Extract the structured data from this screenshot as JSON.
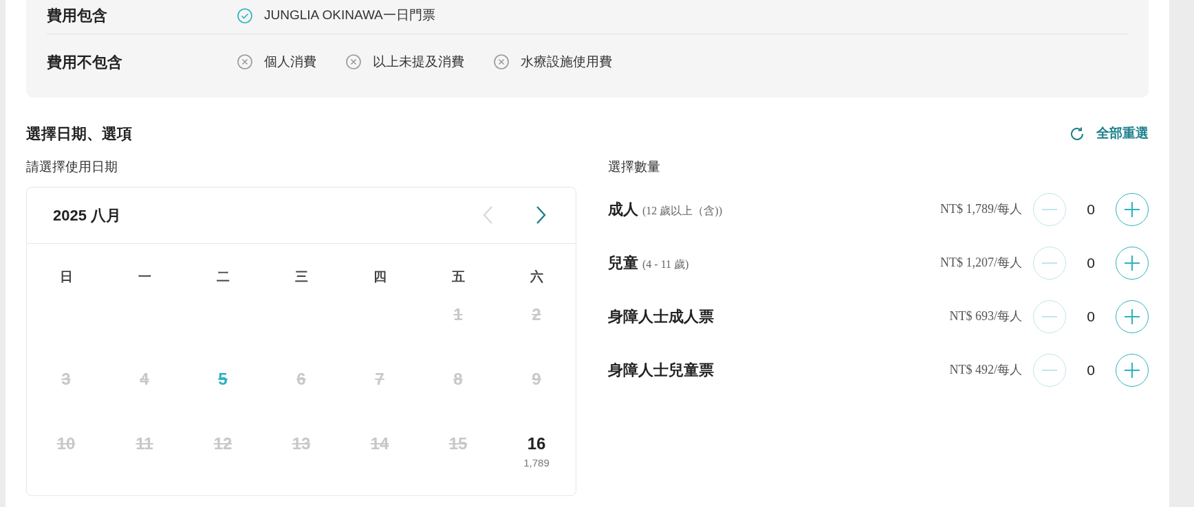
{
  "included": {
    "label": "費用包含",
    "items": [
      "JUNGLIA OKINAWA一日門票"
    ]
  },
  "excluded": {
    "label": "費用不包含",
    "items": [
      "個人消費",
      "以上未提及消費",
      "水療設施使用費"
    ]
  },
  "section_title": "選擇日期、選項",
  "reset": "全部重選",
  "date_label": "請選擇使用日期",
  "calendar": {
    "month": "2025 八月",
    "prev_disabled": true,
    "next_disabled": false,
    "weekdays": [
      "日",
      "一",
      "二",
      "三",
      "四",
      "五",
      "六"
    ],
    "weeks": [
      {
        "days": [
          {
            "day": "1",
            "kind": "unavailable"
          },
          {
            "day": "2",
            "kind": "unavailable"
          }
        ]
      },
      {
        "days": [
          {
            "day": "3",
            "kind": "unavailable"
          },
          {
            "day": "4",
            "kind": "unavailable"
          },
          {
            "day": "5",
            "kind": "today"
          },
          {
            "day": "6",
            "kind": "unavailable"
          },
          {
            "day": "7",
            "kind": "unavailable"
          },
          {
            "day": "8",
            "kind": "unavailable"
          },
          {
            "day": "9",
            "kind": "unavailable"
          }
        ]
      },
      {
        "days": [
          {
            "day": "10",
            "kind": "unavailable"
          },
          {
            "day": "11",
            "kind": "unavailable"
          },
          {
            "day": "12",
            "kind": "unavailable"
          },
          {
            "day": "13",
            "kind": "unavailable"
          },
          {
            "day": "14",
            "kind": "unavailable"
          },
          {
            "day": "15",
            "kind": "unavailable"
          },
          {
            "day": "16",
            "kind": "available",
            "price": "1,789"
          }
        ]
      }
    ]
  },
  "quantity_label": "選擇數量",
  "tickets": [
    {
      "name": "成人",
      "note": "(12 歲以上（含))",
      "price": "NT$ 1,789/每人",
      "count": "0",
      "minus_disabled": true
    },
    {
      "name": "兒童",
      "note": "(4 - 11 歲)",
      "price": "NT$ 1,207/每人",
      "count": "0",
      "minus_disabled": true
    },
    {
      "name": "身障人士成人票",
      "price": "NT$ 693/每人",
      "count": "0",
      "minus_disabled": true
    },
    {
      "name": "身障人士兒童票",
      "price": "NT$ 492/每人",
      "count": "0",
      "minus_disabled": true
    }
  ]
}
